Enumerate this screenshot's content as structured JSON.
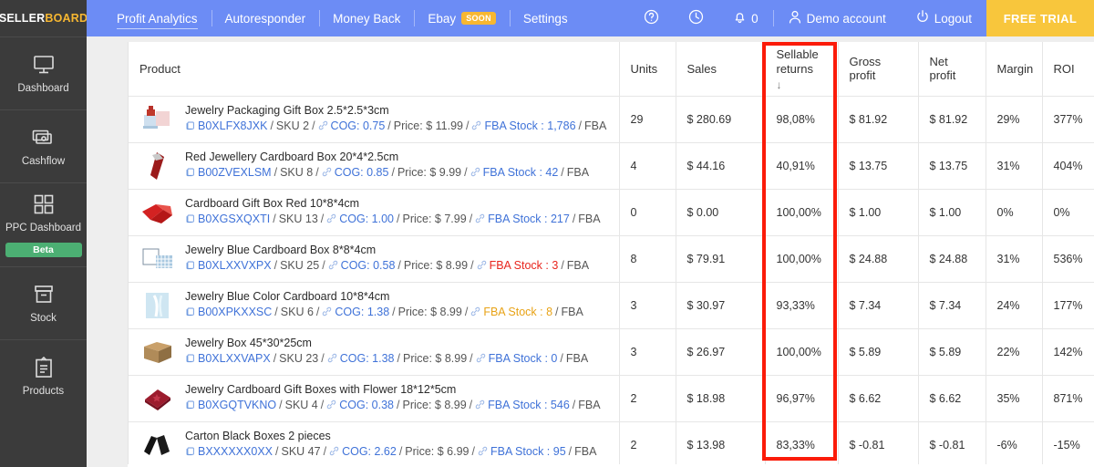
{
  "brand": {
    "part1": "SELLER",
    "part2": "BOARD"
  },
  "sidebar": {
    "items": [
      {
        "label": "Dashboard",
        "icon": "monitor-icon"
      },
      {
        "label": "Cashflow",
        "icon": "money-icon"
      },
      {
        "label": "PPC Dashboard",
        "icon": "grid-icon",
        "badge": "Beta"
      },
      {
        "label": "Stock",
        "icon": "box-icon"
      },
      {
        "label": "Products",
        "icon": "clipboard-icon"
      }
    ]
  },
  "topnav": {
    "links": [
      {
        "label": "Profit Analytics",
        "active": true
      },
      {
        "label": "Autoresponder",
        "active": false
      },
      {
        "label": "Money Back",
        "active": false
      },
      {
        "label": "Ebay",
        "active": false,
        "badge": "SOON"
      },
      {
        "label": "Settings",
        "active": false
      }
    ],
    "help_icon": "question-circle-icon",
    "history_icon": "clock-icon",
    "bell_icon": "bell-icon",
    "bell_count": "0",
    "account_icon": "user-icon",
    "account_label": "Demo account",
    "logout_icon": "power-icon",
    "logout_label": "Logout",
    "free_trial_label": "FREE TRIAL"
  },
  "table": {
    "columns": [
      "Product",
      "Units",
      "Sales",
      "Sellable returns",
      "Gross profit",
      "Net profit",
      "Margin",
      "ROI"
    ],
    "sellable_returns_header_line1": "Sellable",
    "sellable_returns_header_line2": "returns",
    "sort_arrow": "↓",
    "rows": [
      {
        "title": "Jewelry Packaging Gift Box 2.5*2.5*3cm",
        "asin": "B0XLFX8JXK",
        "sku": "SKU 2",
        "cog": "COG: 0.75",
        "price": "Price: $ 11.99",
        "fba_stock": "FBA Stock : 1,786",
        "stock_state": "normal",
        "fulfillment": "FBA",
        "units": "29",
        "sales": "$ 280.69",
        "sellable_returns": "98,08%",
        "gross_profit": "$ 81.92",
        "net_profit": "$ 81.92",
        "margin": "29%",
        "roi": "377%"
      },
      {
        "title": "Red Jewellery Cardboard Box 20*4*2.5cm",
        "asin": "B00ZVEXLSM",
        "sku": "SKU 8",
        "cog": "COG: 0.85",
        "price": "Price: $ 9.99",
        "fba_stock": "FBA Stock : 42",
        "stock_state": "normal",
        "fulfillment": "FBA",
        "units": "4",
        "sales": "$ 44.16",
        "sellable_returns": "40,91%",
        "gross_profit": "$ 13.75",
        "net_profit": "$ 13.75",
        "margin": "31%",
        "roi": "404%"
      },
      {
        "title": "Cardboard Gift Box Red 10*8*4cm",
        "asin": "B0XGSXQXTI",
        "sku": "SKU 13",
        "cog": "COG: 1.00",
        "price": "Price: $ 7.99",
        "fba_stock": "FBA Stock : 217",
        "stock_state": "normal",
        "fulfillment": "FBA",
        "units": "0",
        "sales": "$ 0.00",
        "sellable_returns": "100,00%",
        "gross_profit": "$ 1.00",
        "net_profit": "$ 1.00",
        "margin": "0%",
        "roi": "0%"
      },
      {
        "title": "Jewelry Blue Cardboard Box 8*8*4cm",
        "asin": "B0XLXXVXPX",
        "sku": "SKU 25",
        "cog": "COG: 0.58",
        "price": "Price: $ 8.99",
        "fba_stock": "FBA Stock : 3",
        "stock_state": "critical",
        "fulfillment": "FBA",
        "units": "8",
        "sales": "$ 79.91",
        "sellable_returns": "100,00%",
        "gross_profit": "$ 24.88",
        "net_profit": "$ 24.88",
        "margin": "31%",
        "roi": "536%"
      },
      {
        "title": "Jewelry Blue Color Cardboard 10*8*4cm",
        "asin": "B00XPKXXSC",
        "sku": "SKU 6",
        "cog": "COG: 1.38",
        "price": "Price: $ 8.99",
        "fba_stock": "FBA Stock : 8",
        "stock_state": "warning",
        "fulfillment": "FBA",
        "units": "3",
        "sales": "$ 30.97",
        "sellable_returns": "93,33%",
        "gross_profit": "$ 7.34",
        "net_profit": "$ 7.34",
        "margin": "24%",
        "roi": "177%"
      },
      {
        "title": "Jewelry Box 45*30*25cm",
        "asin": "B0XLXXVAPX",
        "sku": "SKU 23",
        "cog": "COG: 1.38",
        "price": "Price: $ 8.99",
        "fba_stock": "FBA Stock : 0",
        "stock_state": "normal",
        "fulfillment": "FBA",
        "units": "3",
        "sales": "$ 26.97",
        "sellable_returns": "100,00%",
        "gross_profit": "$ 5.89",
        "net_profit": "$ 5.89",
        "margin": "22%",
        "roi": "142%"
      },
      {
        "title": "Jewelry Cardboard Gift Boxes with Flower 18*12*5cm",
        "asin": "B0XGQTVKNO",
        "sku": "SKU 4",
        "cog": "COG: 0.38",
        "price": "Price: $ 8.99",
        "fba_stock": "FBA Stock : 546",
        "stock_state": "normal",
        "fulfillment": "FBA",
        "units": "2",
        "sales": "$ 18.98",
        "sellable_returns": "96,97%",
        "gross_profit": "$ 6.62",
        "net_profit": "$ 6.62",
        "margin": "35%",
        "roi": "871%"
      },
      {
        "title": "Carton Black Boxes 2 pieces",
        "asin": "BXXXXXX0XX",
        "sku": "SKU 47",
        "cog": "COG: 2.62",
        "price": "Price: $ 6.99",
        "fba_stock": "FBA Stock : 95",
        "stock_state": "normal",
        "fulfillment": "FBA",
        "units": "2",
        "sales": "$ 13.98",
        "sellable_returns": "83,33%",
        "gross_profit": "$ -0.81",
        "net_profit": "$ -0.81",
        "margin": "-6%",
        "roi": "-15%"
      }
    ]
  },
  "highlight": {
    "color": "#fb1b09",
    "target_column": "Sellable returns"
  },
  "colors": {
    "nav_blue": "#6c8cf5",
    "sidebar_dark": "#3b3b3b",
    "accent_yellow": "#f7b731",
    "link_blue": "#3f72d8",
    "beta_green": "#4caf73"
  }
}
